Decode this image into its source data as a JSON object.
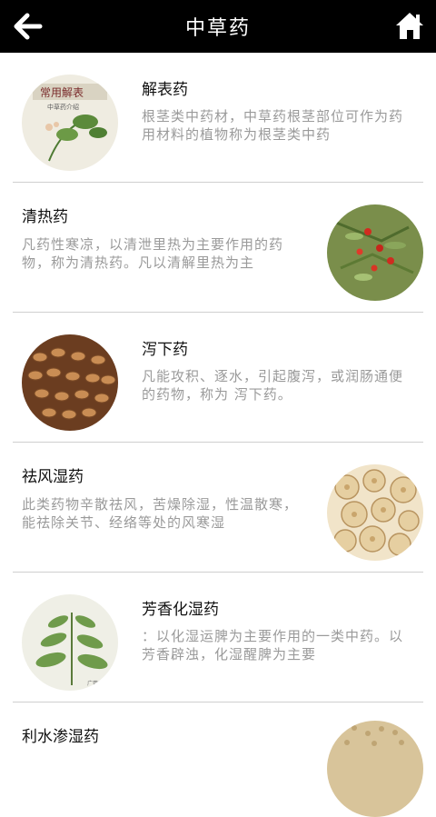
{
  "header": {
    "title": "中草药"
  },
  "items": [
    {
      "name": "解表药",
      "desc": "根茎类中药材，中草药根茎部位可作为药用材料的植物称为根茎类中药",
      "image_icon": "herb-book-image"
    },
    {
      "name": "清热药",
      "desc": "凡药性寒凉，以清泄里热为主要作用的药物，称为清热药。凡以清解里热为主",
      "image_icon": "red-berries-image"
    },
    {
      "name": "泻下药",
      "desc": "凡能攻积、逐水，引起腹泻，或润肠通便的药物，称为 泻下药。",
      "image_icon": "seeds-image"
    },
    {
      "name": "祛风湿药",
      "desc": "此类药物辛散祛风，苦燥除湿，性温散寒，能祛除关节、经络等处的风寒湿",
      "image_icon": "root-slices-image"
    },
    {
      "name": "芳香化湿药",
      "desc": "：以化湿运脾为主要作用的一类中药。以芳香辟浊，化湿醒脾为主要",
      "image_icon": "herb-plant-image"
    },
    {
      "name": "利水渗湿药",
      "desc": "",
      "image_icon": "grain-pile-image"
    }
  ]
}
